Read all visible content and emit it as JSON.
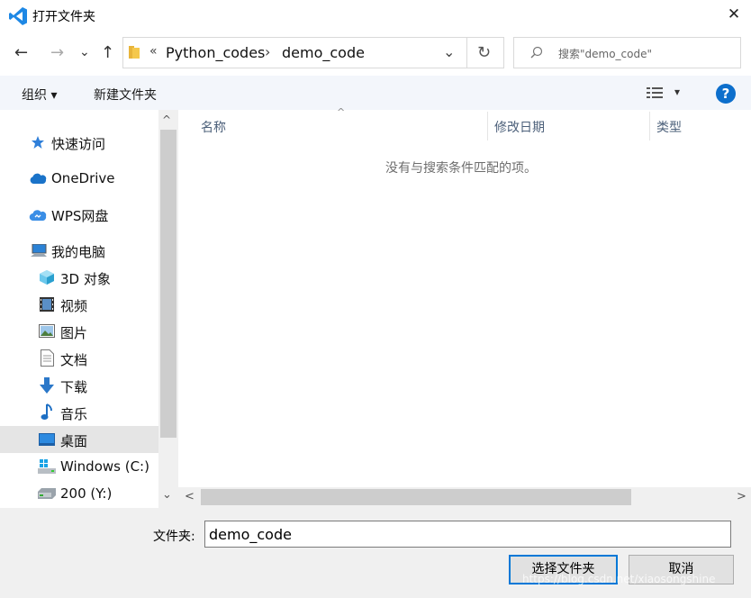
{
  "window": {
    "title": "打开文件夹",
    "close_glyph": "✕"
  },
  "nav": {
    "back_glyph": "←",
    "forward_glyph": "→",
    "recent_glyph": "⌄",
    "up_glyph": "↑"
  },
  "address": {
    "overflow": "«",
    "crumbs": [
      "Python_codes",
      "demo_code"
    ],
    "sep": "›",
    "dropdown_glyph": "⌄",
    "refresh_glyph": "↻"
  },
  "search": {
    "placeholder": "搜索\"demo_code\""
  },
  "toolbar": {
    "organize": "组织 ▾",
    "new_folder": "新建文件夹",
    "view_dropdown": "▾",
    "help": "?"
  },
  "sidebar": {
    "items": [
      {
        "label": "快速访问",
        "icon": "quick-access-star-icon"
      },
      {
        "label": "OneDrive",
        "icon": "onedrive-cloud-icon"
      },
      {
        "label": "WPS网盘",
        "icon": "wps-cloud-icon"
      },
      {
        "label": "我的电脑",
        "icon": "computer-icon"
      },
      {
        "label": "3D 对象",
        "icon": "3d-objects-icon"
      },
      {
        "label": "视频",
        "icon": "video-icon"
      },
      {
        "label": "图片",
        "icon": "pictures-icon"
      },
      {
        "label": "文档",
        "icon": "documents-icon"
      },
      {
        "label": "下载",
        "icon": "download-icon"
      },
      {
        "label": "音乐",
        "icon": "music-icon"
      },
      {
        "label": "桌面",
        "icon": "desktop-icon",
        "selected": true
      },
      {
        "label": "Windows (C:)",
        "icon": "windows-drive-icon"
      },
      {
        "label": "200 (Y:)",
        "icon": "network-drive-icon"
      }
    ],
    "scroll_up": "^",
    "scroll_down": "⌄"
  },
  "files": {
    "columns": [
      "名称",
      "修改日期",
      "类型"
    ],
    "sort_indicator": "^",
    "empty_message": "没有与搜索条件匹配的项。",
    "scroll_left": "<",
    "scroll_right": ">"
  },
  "footer": {
    "folder_label": "文件夹:",
    "folder_value": "demo_code",
    "select_button": "选择文件夹",
    "cancel_button": "取消"
  },
  "watermark": "https://blog.csdn.net/xiaosongshine",
  "colors": {
    "accent": "#0078d7",
    "toolbar_bg": "#f3f6fb",
    "selected_bg": "#e5e5e5",
    "footer_bg": "#f0f0f0"
  }
}
